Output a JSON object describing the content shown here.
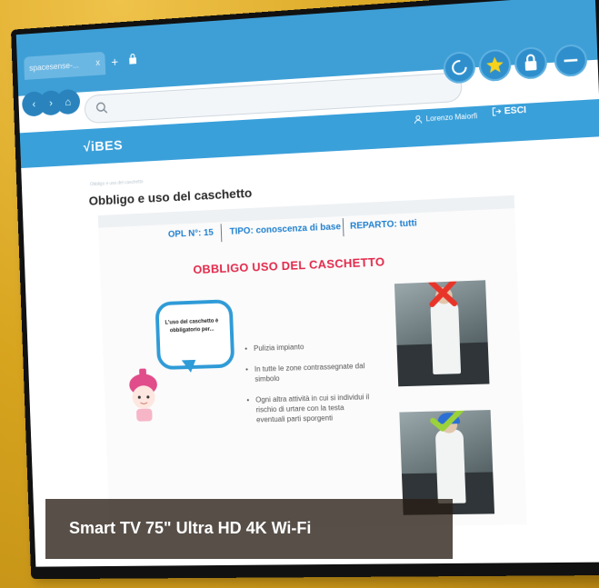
{
  "browser": {
    "tab_title": "spacesense-...",
    "tab_close": "x",
    "new_tab": "+",
    "url": ""
  },
  "app": {
    "brand": "√iBES",
    "user_name": "Lorenzo Maiorfi",
    "logout_label": "ESCI",
    "breadcrumb": "Obbligo e uso del caschetto",
    "page_title": "Obbligo e uso del caschetto"
  },
  "slide": {
    "opl": "OPL N°: 15",
    "tipo": "TIPO: conoscenza di base",
    "reparto": "REPARTO: tutti",
    "heading": "OBBLIGO USO DEL CASCHETTO",
    "bubble_text": "L'uso del caschetto è obbligatorio per...",
    "bullets": [
      "Pulizia impianto",
      "In tutte le zone contrassegnate dal simbolo",
      "Ogni altra attività in cui si individui il rischio di urtare con la testa eventuali parti sporgenti"
    ],
    "photo_wrong_icon": "red-x-icon",
    "photo_right_icon": "green-check-icon"
  },
  "caption": {
    "text": "Smart TV 75\" Ultra HD 4K Wi-Fi"
  },
  "colors": {
    "wall": "#d9a92a",
    "app_blue": "#3aa0da",
    "accent_red": "#e2294a",
    "info_blue": "#1e7fcf"
  }
}
